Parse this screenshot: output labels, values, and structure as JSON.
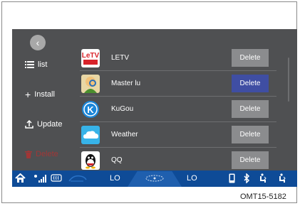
{
  "back_icon": "chevron-left-icon",
  "sidebar": {
    "items": [
      {
        "label": "list",
        "icon": "list-icon"
      },
      {
        "label": "Install",
        "icon": "plus-icon"
      },
      {
        "label": "Update",
        "icon": "upload-icon"
      },
      {
        "label": "Delete",
        "icon": "trash-icon"
      }
    ]
  },
  "apps": [
    {
      "name": "LETV",
      "delete_label": "Delete",
      "icon_logo": "LeTV",
      "active": false
    },
    {
      "name": "Master lu",
      "delete_label": "Delete",
      "active": true
    },
    {
      "name": "KuGou",
      "delete_label": "Delete",
      "icon_logo": "K",
      "active": false
    },
    {
      "name": "Weather",
      "delete_label": "Delete",
      "active": false
    },
    {
      "name": "QQ",
      "delete_label": "Delete",
      "active": false
    }
  ],
  "status_bar": {
    "home_icon": "home-icon",
    "signal_icon": "signal-icon",
    "defrost_icon": "rear-defrost-icon",
    "recirculation_icon": "recirculation-icon",
    "temp_left": "LO",
    "fan_icon": "fan-icon",
    "temp_right": "LO",
    "phone_icon": "phone-icon",
    "bluetooth_icon": "bluetooth-icon",
    "seat_heat_left_icon": "seat-heat-left-icon",
    "seat_heat_right_icon": "seat-heat-right-icon"
  },
  "caption": "OMT15-5182",
  "colors": {
    "screen_bg": "#4f5052",
    "status_bar_bg": "#0e4b97",
    "delete_button": "#8b8c8e",
    "delete_button_active": "#3f4ea3",
    "sidebar_dim_text": "#a13636"
  }
}
